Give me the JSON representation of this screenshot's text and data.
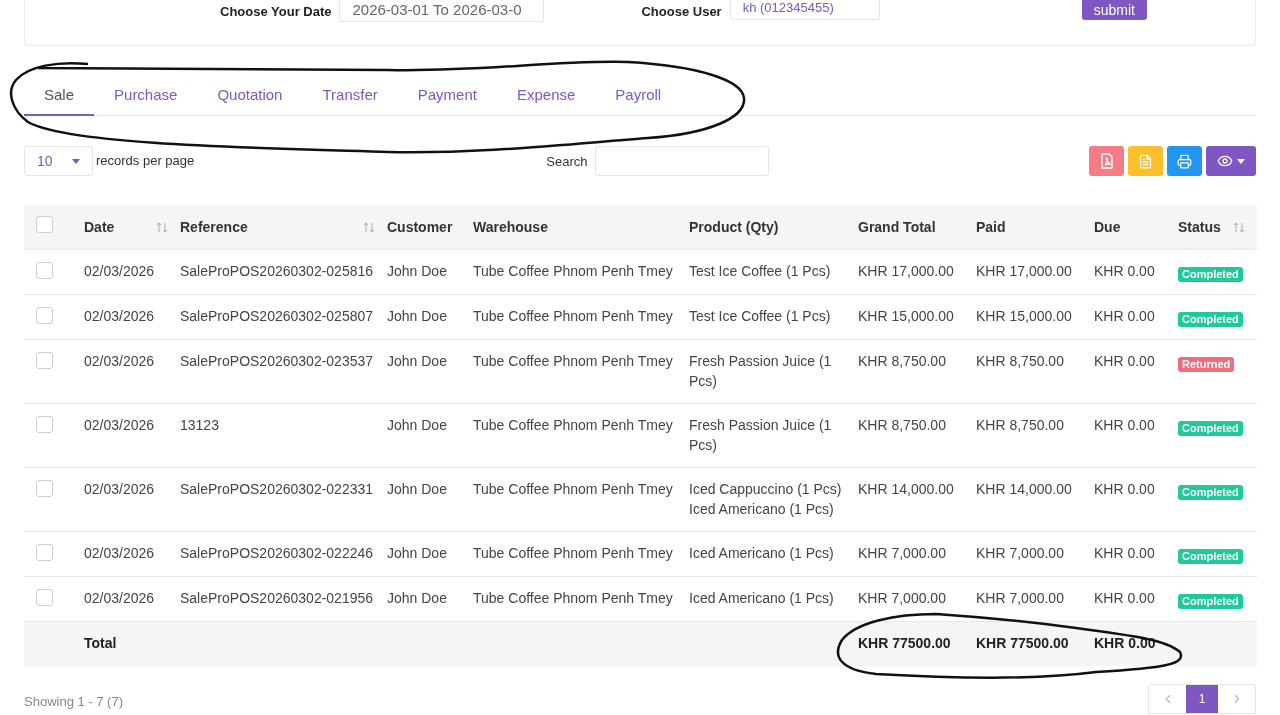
{
  "filters": {
    "date_label": "Choose Your Date",
    "date_value": "2026-03-01 To 2026-03-0",
    "user_label": "Choose User",
    "user_value": "kh (012345455)",
    "submit": "submit"
  },
  "tabs": [
    {
      "label": "Sale",
      "selected": true
    },
    {
      "label": "Purchase",
      "selected": false
    },
    {
      "label": "Quotation",
      "selected": false
    },
    {
      "label": "Transfer",
      "selected": false
    },
    {
      "label": "Payment",
      "selected": false
    },
    {
      "label": "Expense",
      "selected": false
    },
    {
      "label": "Payroll",
      "selected": false
    }
  ],
  "length_select": {
    "value": "10",
    "label": "records per page"
  },
  "search": {
    "label": "Search"
  },
  "export_buttons": [
    {
      "kind": "pdf",
      "color": "#f47c89"
    },
    {
      "kind": "csv",
      "color": "#fcc02b"
    },
    {
      "kind": "print",
      "color": "#2196f3"
    },
    {
      "kind": "columns",
      "color": "#7e57c2"
    }
  ],
  "table": {
    "select_all": {
      "checked": false
    },
    "columns": [
      {
        "label": "Date",
        "sortable": true
      },
      {
        "label": "Reference",
        "sortable": true
      },
      {
        "label": "Customer",
        "sortable": false
      },
      {
        "label": "Warehouse",
        "sortable": false
      },
      {
        "label": "Product (Qty)",
        "sortable": false
      },
      {
        "label": "Grand Total",
        "sortable": false
      },
      {
        "label": "Paid",
        "sortable": false
      },
      {
        "label": "Due",
        "sortable": false
      },
      {
        "label": "Status",
        "sortable": true
      }
    ],
    "rows": [
      {
        "checked": false,
        "date": "02/03/2026",
        "reference": "SaleProPOS20260302-025816",
        "customer": "John Doe",
        "warehouse": "Tube Coffee Phnom Penh Tmey",
        "products": [
          "Test Ice Coffee (1 Pcs)"
        ],
        "grand_total": "KHR 17,000.00",
        "paid": "KHR 17,000.00",
        "due": "KHR 0.00",
        "status": {
          "label": "Completed",
          "kind": "completed"
        }
      },
      {
        "checked": false,
        "date": "02/03/2026",
        "reference": "SaleProPOS20260302-025807",
        "customer": "John Doe",
        "warehouse": "Tube Coffee Phnom Penh Tmey",
        "products": [
          "Test Ice Coffee (1 Pcs)"
        ],
        "grand_total": "KHR 15,000.00",
        "paid": "KHR 15,000.00",
        "due": "KHR 0.00",
        "status": {
          "label": "Completed",
          "kind": "completed"
        }
      },
      {
        "checked": false,
        "date": "02/03/2026",
        "reference": "SaleProPOS20260302-023537",
        "customer": "John Doe",
        "warehouse": "Tube Coffee Phnom Penh Tmey",
        "products": [
          "Fresh Passion Juice (1 Pcs)"
        ],
        "grand_total": "KHR 8,750.00",
        "paid": "KHR 8,750.00",
        "due": "KHR 0.00",
        "status": {
          "label": "Returned",
          "kind": "returned"
        }
      },
      {
        "checked": false,
        "date": "02/03/2026",
        "reference": "13123",
        "customer": "John Doe",
        "warehouse": "Tube Coffee Phnom Penh Tmey",
        "products": [
          "Fresh Passion Juice (1 Pcs)"
        ],
        "grand_total": "KHR 8,750.00",
        "paid": "KHR 8,750.00",
        "due": "KHR 0.00",
        "status": {
          "label": "Completed",
          "kind": "completed"
        }
      },
      {
        "checked": false,
        "date": "02/03/2026",
        "reference": "SaleProPOS20260302-022331",
        "customer": "John Doe",
        "warehouse": "Tube Coffee Phnom Penh Tmey",
        "products": [
          "Iced Cappuccino (1 Pcs)",
          "Iced Americano (1 Pcs)"
        ],
        "grand_total": "KHR 14,000.00",
        "paid": "KHR 14,000.00",
        "due": "KHR 0.00",
        "status": {
          "label": "Completed",
          "kind": "completed"
        }
      },
      {
        "checked": false,
        "date": "02/03/2026",
        "reference": "SaleProPOS20260302-022246",
        "customer": "John Doe",
        "warehouse": "Tube Coffee Phnom Penh Tmey",
        "products": [
          "Iced Americano (1 Pcs)"
        ],
        "grand_total": "KHR 7,000.00",
        "paid": "KHR 7,000.00",
        "due": "KHR 0.00",
        "status": {
          "label": "Completed",
          "kind": "completed"
        }
      },
      {
        "checked": false,
        "date": "02/03/2026",
        "reference": "SaleProPOS20260302-021956",
        "customer": "John Doe",
        "warehouse": "Tube Coffee Phnom Penh Tmey",
        "products": [
          "Iced Americano (1 Pcs)"
        ],
        "grand_total": "KHR 7,000.00",
        "paid": "KHR 7,000.00",
        "due": "KHR 0.00",
        "status": {
          "label": "Completed",
          "kind": "completed"
        }
      }
    ],
    "totals": {
      "label": "Total",
      "grand_total": "KHR 77500.00",
      "paid": "KHR 77500.00",
      "due": "KHR 0.00"
    }
  },
  "footer": {
    "showing": "Showing 1 - 7 (7)",
    "pages": [
      {
        "label": "1",
        "selected": true
      }
    ]
  }
}
